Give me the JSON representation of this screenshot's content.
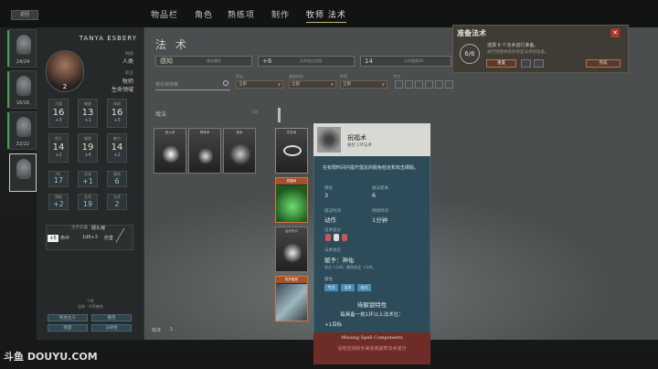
{
  "top_bar": {
    "back_label": "返回",
    "tabs": [
      "物品栏",
      "角色",
      "熟练项",
      "制作",
      "牧师 法术"
    ]
  },
  "party": [
    {
      "hp": "24/24"
    },
    {
      "hp": "16/16"
    },
    {
      "hp": "22/22"
    },
    {
      "hp": ""
    }
  ],
  "character": {
    "name": "TANYA ESBERY",
    "level": "2",
    "race_label": "种族",
    "race": "人类",
    "class_label": "职业",
    "class": "牧师",
    "domain": "生命领域",
    "stats": [
      {
        "k": "力量",
        "v": "16",
        "m": "+3"
      },
      {
        "k": "敏捷",
        "v": "13",
        "m": "+1"
      },
      {
        "k": "体质",
        "v": "16",
        "m": "+3"
      },
      {
        "k": "智力",
        "v": "14",
        "m": "+2"
      },
      {
        "k": "感知",
        "v": "19",
        "m": "+4"
      },
      {
        "k": "魅力",
        "v": "14",
        "m": "+2"
      }
    ],
    "sub_stats": [
      {
        "k": "AC",
        "v": "17"
      },
      {
        "k": "先攻",
        "v": "+1"
      },
      {
        "k": "豁免",
        "v": "6"
      },
      {
        "k": "熟练",
        "v": "+2"
      },
      {
        "k": "生命",
        "v": "19"
      },
      {
        "k": "法术",
        "v": "2"
      }
    ],
    "weapon_label": "主手武器",
    "weapon_name": "硬头锤",
    "hit_bonus": "+5",
    "hit_label": "命中",
    "damage": "1d6+3",
    "damage_label": "伤害",
    "buttons": [
      "利他主义",
      "敬畏",
      "随意",
      "法律性"
    ],
    "trait_header": "个性",
    "trait_sub": "信仰 · 守序善良"
  },
  "spells": {
    "title": "法 术",
    "attribute_label": "施法属性",
    "attribute_value": "感知",
    "attack_label": "法术攻击加值",
    "attack_value": "+6",
    "dc_label": "法术豁免DC",
    "dc_value": "14",
    "search_placeholder": "按名称搜索",
    "filter_labels": [
      "学派",
      "施放时间",
      "射程",
      "专注",
      "仪式"
    ],
    "filter_values": [
      "全部",
      "全部",
      "全部",
      "全部"
    ],
    "cantrip_label": "戏法",
    "level_label": "1环",
    "known_label": "已知法术",
    "prepared_label": "已准备",
    "cantrips": [
      "圣火术",
      "神导术",
      "奇术",
      "光亮术"
    ],
    "prepared": [
      "祝福术",
      "治疗伤口",
      "命令术",
      "防护善恶"
    ],
    "bottom_label": "戏法",
    "bottom_count": "1"
  },
  "tooltip": {
    "name": "祝福术",
    "subtitle": "惑控 1环法术",
    "description": "在有限时间内提升盟友的骰免检定和攻击掷骰。",
    "target_label": "目标",
    "target_value": "3",
    "range_label": "施法距离",
    "range_value": "6",
    "casting_label": "施法时间",
    "casting_value": "动作",
    "duration_label": "持续时间",
    "duration_value": "1分钟",
    "component_label": "法术成分",
    "properties_label": "法术效应",
    "effect": "赋予：神佑",
    "effect_detail": "攻击 +1d4，豁免检定 +1d4。",
    "tags_label": "属性",
    "tags": [
      "专注",
      "法术",
      "仪式"
    ],
    "upcast_title": "待解锁特性",
    "upcast_text": "每具备一枚1环以上法术位：",
    "upcast_bonus": "+1目标",
    "footer_title": "Missing Spell Components",
    "footer_text": "没有空闲的手来完成姿势法术成分"
  },
  "prepare_panel": {
    "title": "准备法术",
    "count": "6/6",
    "text": "选择 6 个法术进行准备。",
    "subtext": "进行短暂休息时改变法术的准备。",
    "reset_label": "重置",
    "confirm_label": "完成"
  },
  "watermark": "斗鱼 DOUYU.COM"
}
